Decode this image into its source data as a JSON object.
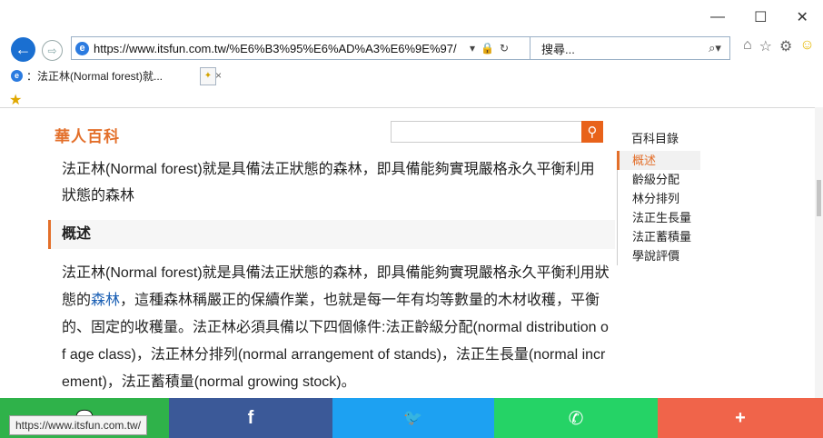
{
  "browser": {
    "window_controls": [
      "—",
      "☐",
      "✕"
    ],
    "address": "https://www.itsfun.com.tw/%E6%B3%95%E6%AD%A3%E6%9E%97/",
    "search_placeholder": "搜尋...",
    "tab_title": "：法正林(Normal forest)就...",
    "status_url": "https://www.itsfun.com.tw/"
  },
  "page": {
    "logo": "華人百科",
    "intro": "法正林(Normal forest)就是具備法正狀態的森林，即具備能夠實現嚴格永久平衡利用狀態的森林",
    "section_title": "概述",
    "section_text_before": "法正林(Normal forest)就是具備法正狀態的森林，即具備能夠實現嚴格永久平衡利用狀態的",
    "section_link": "森林",
    "section_text_after": "，這種森林稱嚴正的保續作業，也就是每一年有均等數量的木材收穫，平衡的、固定的收穫量。法正林必須具備以下四個條件:法正齡級分配(normal distribution of age class)，法正林分排列(normal arrangement of stands)，法正生長量(normal increment)，法正蓄積量(normal growing stock)。"
  },
  "toc": {
    "title": "百科目錄",
    "items": [
      "概述",
      "齡級分配",
      "林分排列",
      "法正生長量",
      "法正蓄積量",
      "學說評價"
    ]
  },
  "share": {
    "buttons": [
      {
        "name": "share-button",
        "glyph": "",
        "color": "#2fb24a"
      },
      {
        "name": "facebook-button",
        "glyph": "f",
        "color": "#3b5998"
      },
      {
        "name": "twitter-button",
        "glyph": "🐦",
        "color": "#1da1f2"
      },
      {
        "name": "whatsapp-button",
        "glyph": "✆",
        "color": "#25d366"
      },
      {
        "name": "more-share-button",
        "glyph": "+",
        "color": "#f0644a"
      }
    ]
  },
  "colors": {
    "accent": "#e36f2a",
    "link": "#1a5fb4"
  }
}
